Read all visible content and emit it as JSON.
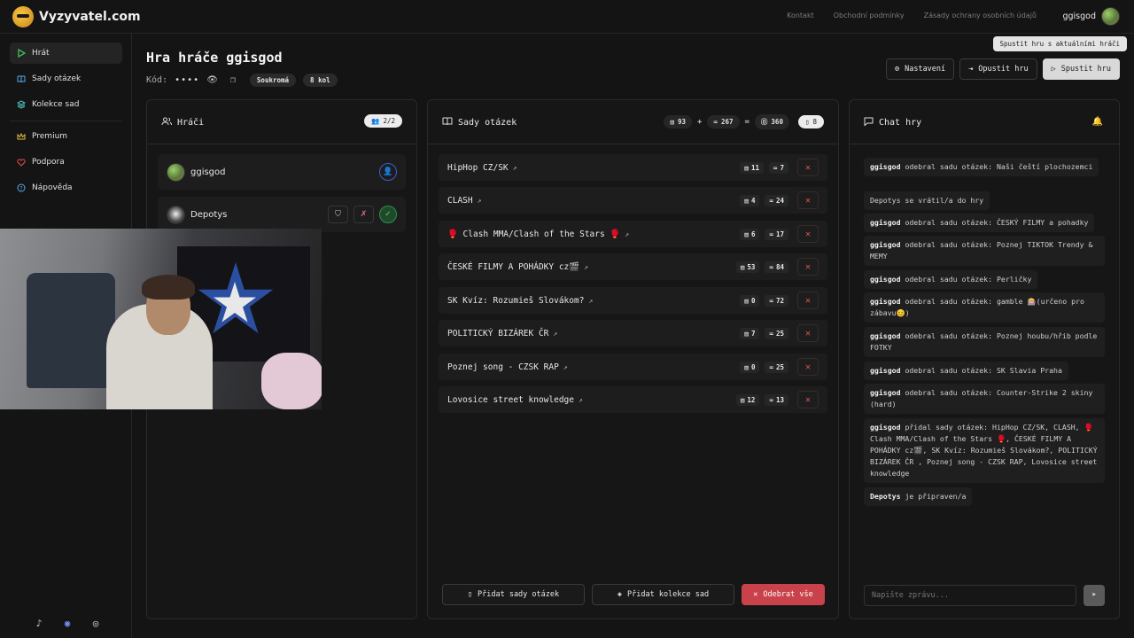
{
  "app": {
    "logo_text": "Vyzyvatel.com"
  },
  "top_links": [
    "Kontakt",
    "Obchodní podmínky",
    "Zásady ochrany osobních údajů"
  ],
  "user": {
    "name": "ggisgod"
  },
  "sidebar": {
    "items": [
      {
        "label": "Hrát",
        "icon": "play-icon"
      },
      {
        "label": "Sady otázek",
        "icon": "book-icon"
      },
      {
        "label": "Kolekce sad",
        "icon": "layers-icon"
      },
      {
        "label": "Premium",
        "icon": "crown-icon"
      },
      {
        "label": "Podpora",
        "icon": "heart-icon"
      },
      {
        "label": "Nápověda",
        "icon": "help-icon"
      }
    ],
    "social": [
      "tiktok-icon",
      "discord-icon",
      "instagram-icon"
    ]
  },
  "header": {
    "title": "Hra hráče ggisgod",
    "code_label": "Kód:",
    "code_value": "••••",
    "privacy": "Soukromá",
    "rounds": "8 kol",
    "settings_label": "Nastavení",
    "leave_label": "Opustit hru",
    "start_label": "Spustit hru",
    "tooltip": "Spustit hru s aktuálními hráči"
  },
  "players_panel": {
    "title": "Hráči",
    "count": "2/2",
    "players": [
      {
        "name": "ggisgod"
      },
      {
        "name": "Depotys"
      }
    ]
  },
  "sets_panel": {
    "title": "Sady otázek",
    "totals": {
      "sets": "93",
      "plus": "+",
      "questions": "267",
      "equals": "=",
      "total": "360",
      "count": "8"
    },
    "sets": [
      {
        "name": "HipHop CZ/SK",
        "a": "11",
        "b": "7"
      },
      {
        "name": "CLASH",
        "a": "4",
        "b": "24"
      },
      {
        "name": "🥊 Clash MMA/Clash of the Stars 🥊",
        "a": "6",
        "b": "17"
      },
      {
        "name": "ČESKÉ FILMY A POHÁDKY cz🎬",
        "a": "53",
        "b": "84"
      },
      {
        "name": "SK Kvíz: Rozumieš Slovákom?",
        "a": "0",
        "b": "72"
      },
      {
        "name": "POLITICKÝ BIZÁREK ČR",
        "a": "7",
        "b": "25"
      },
      {
        "name": "Poznej song - CZSK RAP",
        "a": "0",
        "b": "25"
      },
      {
        "name": "Lovosice street knowledge",
        "a": "12",
        "b": "13"
      }
    ],
    "add_sets_label": "Přidat sady otázek",
    "add_collection_label": "Přidat kolekce sad",
    "remove_all_label": "Odebrat vše"
  },
  "chat": {
    "title": "Chat hry",
    "messages": [
      {
        "user": "ggisgod",
        "text": " odebral sadu otázek: Naši čeští plochozemci"
      },
      {
        "user": "",
        "text": "Depotys se vrátil/a do hry"
      },
      {
        "user": "ggisgod",
        "text": " odebral sadu otázek: ČESKÝ FILMY a pohadky"
      },
      {
        "user": "ggisgod",
        "text": " odebral sadu otázek: Poznej TIKTOK Trendy & MEMY"
      },
      {
        "user": "ggisgod",
        "text": " odebral sadu otázek: Perličky"
      },
      {
        "user": "ggisgod",
        "text": " odebral sadu otázek: gamble 🎰(určeno pro zábavu😊)"
      },
      {
        "user": "ggisgod",
        "text": " odebral sadu otázek: Poznej houbu/hřib podle FOTKY"
      },
      {
        "user": "ggisgod",
        "text": " odebral sadu otázek: SK Slavia Praha"
      },
      {
        "user": "ggisgod",
        "text": " odebral sadu otázek: Counter-Strike 2 skiny (hard)"
      },
      {
        "user": "ggisgod",
        "text": " přidal sady otázek: HipHop CZ/SK, CLASH, 🥊 Clash MMA/Clash of the Stars 🥊, ČESKÉ FILMY A POHÁDKY cz🎬, SK Kvíz: Rozumieš Slovákom?, POLITICKÝ BIZÁREK ČR , Poznej song - CZSK RAP, Lovosice street knowledge"
      },
      {
        "user": "Depotys",
        "text": " je připraven/a"
      }
    ],
    "input_placeholder": "Napište zprávu..."
  }
}
